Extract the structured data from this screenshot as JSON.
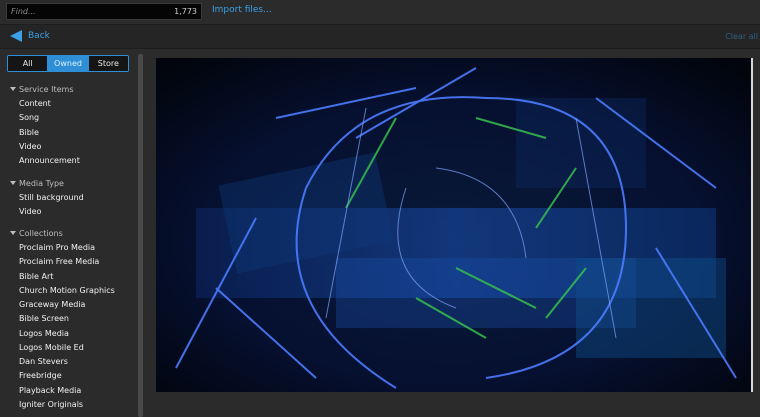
{
  "search": {
    "placeholder": "Find...",
    "count": "1,773"
  },
  "import_label": "Import files...",
  "back_label": "Back",
  "clear_all_label": "Clear all",
  "filter_tabs": [
    {
      "label": "All",
      "active": false
    },
    {
      "label": "Owned",
      "active": true
    },
    {
      "label": "Store",
      "active": false
    }
  ],
  "sections": {
    "service_items": {
      "title": "Service Items",
      "items": [
        "Content",
        "Song",
        "Bible",
        "Video",
        "Announcement"
      ]
    },
    "media_type": {
      "title": "Media Type",
      "items": [
        "Still background",
        "Video"
      ]
    },
    "collections": {
      "title": "Collections",
      "items": [
        "Proclaim Pro Media",
        "Proclaim Free Media",
        "Bible Art",
        "Church Motion Graphics",
        "Graceway Media",
        "Bible Screen",
        "Logos Media",
        "Logos Mobile Ed",
        "Dan Stevers",
        "Freebridge",
        "Playback Media",
        "Igniter Originals"
      ]
    }
  },
  "colors": {
    "accent": "#3aa1e8",
    "background": "#2b2b2b"
  }
}
